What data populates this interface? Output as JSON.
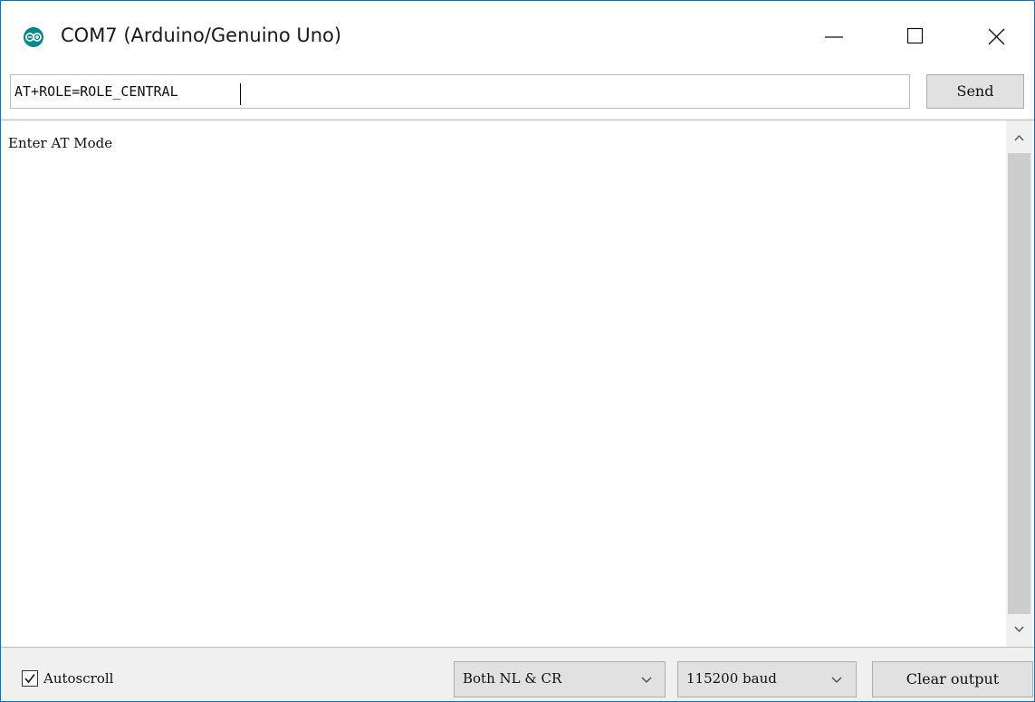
{
  "window": {
    "title": "COM7 (Arduino/Genuino Uno)",
    "app_icon": "arduino-logo-icon",
    "controls": {
      "minimize_icon": "minimize-icon",
      "maximize_icon": "maximize-icon",
      "close_icon": "close-icon"
    }
  },
  "send_row": {
    "input_value": "AT+ROLE=ROLE_CENTRAL",
    "send_label": "Send"
  },
  "output": {
    "lines": [
      "Enter AT Mode"
    ]
  },
  "bottom_bar": {
    "autoscroll_label": "Autoscroll",
    "autoscroll_checked": true,
    "line_ending_selected": "Both NL & CR",
    "baud_selected": "115200 baud",
    "clear_label": "Clear output"
  },
  "colors": {
    "window_border": "#0a74c9",
    "arduino_teal": "#00878f",
    "button_face": "#e1e1e1"
  }
}
